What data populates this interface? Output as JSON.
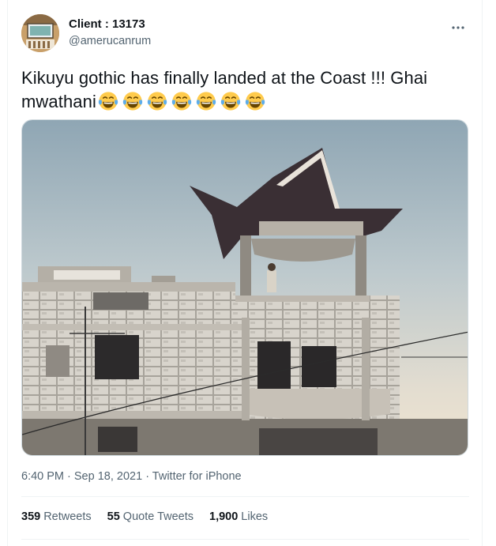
{
  "author": {
    "display_name": "Client : 13173",
    "handle": "@amerucanrum"
  },
  "tweet": {
    "text": "Kikuyu gothic has finally landed at the Coast !!! Ghai mwathani",
    "emoji": "face-with-tears-of-joy",
    "emoji_count": 7
  },
  "meta": {
    "time": "6:40 PM",
    "separator": " · ",
    "date": "Sep 18, 2021",
    "source": "Twitter for iPhone"
  },
  "stats": {
    "retweets_count": "359",
    "retweets_label": "Retweets",
    "quotes_count": "55",
    "quotes_label": "Quote Tweets",
    "likes_count": "1,900",
    "likes_label": "Likes"
  },
  "colors": {
    "text_primary": "#0f1419",
    "text_secondary": "#536471",
    "border": "#eff3f4"
  }
}
